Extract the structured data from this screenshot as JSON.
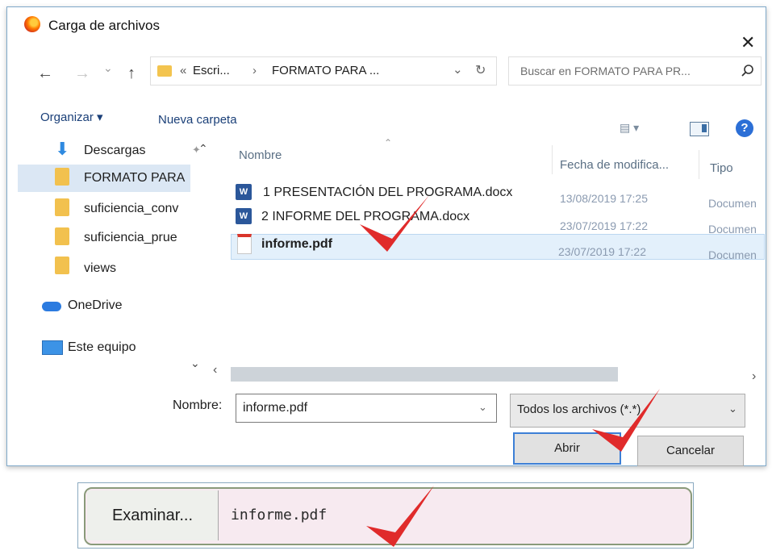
{
  "dialog": {
    "title": "Carga de archivos",
    "close_glyph": "✕",
    "nav": {
      "back": "←",
      "forward": "→",
      "recent": "⌄",
      "up": "↑"
    },
    "address": {
      "prefix": "«",
      "crumb1": "Escri...",
      "sep": "›",
      "crumb2": "FORMATO PARA ...",
      "dropdown": "⌄",
      "refresh": "↻"
    },
    "search_placeholder": "Buscar en FORMATO PARA PR...",
    "toolbar": {
      "organize": "Organizar ▾",
      "new_folder": "Nueva carpeta",
      "help": "?"
    },
    "sidebar": [
      {
        "label": "Descargas",
        "icon": "download-arrow-icon",
        "pinned": true
      },
      {
        "label": "FORMATO PARA",
        "icon": "folder-icon",
        "selected": true
      },
      {
        "label": "suficiencia_conv",
        "icon": "folder-icon"
      },
      {
        "label": "suficiencia_prue",
        "icon": "folder-icon"
      },
      {
        "label": "views",
        "icon": "folder-icon"
      },
      {
        "label": "OneDrive",
        "icon": "cloud-icon"
      },
      {
        "label": "Este equipo",
        "icon": "computer-icon"
      }
    ],
    "columns": {
      "name": "Nombre",
      "date": "Fecha de modifica...",
      "type": "Tipo"
    },
    "files": [
      {
        "name": "1 PRESENTACIÓN DEL PROGRAMA.docx",
        "date": "13/08/2019 17:25",
        "type": "Documen",
        "icon": "word-icon"
      },
      {
        "name": "2 INFORME DEL PROGRAMA.docx",
        "date": "23/07/2019 17:22",
        "type": "Documen",
        "icon": "word-icon"
      },
      {
        "name": "informe.pdf",
        "date": "23/07/2019 17:22",
        "type": "Documen",
        "icon": "pdf-icon",
        "selected": true
      }
    ],
    "filename_label": "Nombre:",
    "filename_value": "informe.pdf",
    "filter_value": "Todos los archivos (*.*)",
    "open_button": "Abrir",
    "cancel_button": "Cancelar",
    "accent_color": "#3c7fd6"
  },
  "browse": {
    "button": "Examinar...",
    "value": "informe.pdf"
  },
  "annotation": {
    "check_color": "#e02b2b"
  }
}
